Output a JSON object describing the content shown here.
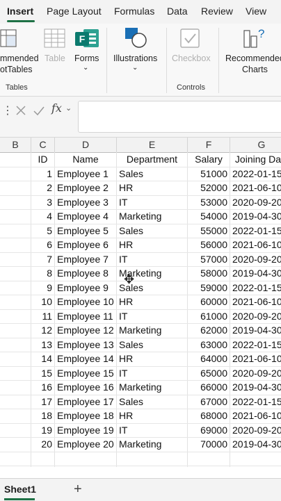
{
  "ribbon_tabs": [
    "Insert",
    "Page Layout",
    "Formulas",
    "Data",
    "Review",
    "View"
  ],
  "active_tab": "Insert",
  "ribbon": {
    "pivot_label_1": "mmended",
    "pivot_label_2": "otTables",
    "table_label": "Table",
    "forms_label": "Forms",
    "forms_letter": "F",
    "illustrations_label": "Illustrations",
    "checkbox_label": "Checkbox",
    "rec_charts_label_1": "Recommended",
    "rec_charts_label_2": "Charts",
    "group_tables": "Tables",
    "group_controls": "Controls"
  },
  "formula_bar": {
    "fx": "fx",
    "value": ""
  },
  "columns": [
    "B",
    "C",
    "D",
    "E",
    "F",
    "G"
  ],
  "headers": [
    "ID",
    "Name",
    "Department",
    "Salary",
    "Joining Da"
  ],
  "rows": [
    [
      "1",
      "Employee 1",
      "Sales",
      "51000",
      "2022-01-15"
    ],
    [
      "2",
      "Employee 2",
      "HR",
      "52000",
      "2021-06-10"
    ],
    [
      "3",
      "Employee 3",
      "IT",
      "53000",
      "2020-09-20"
    ],
    [
      "4",
      "Employee 4",
      "Marketing",
      "54000",
      "2019-04-30"
    ],
    [
      "5",
      "Employee 5",
      "Sales",
      "55000",
      "2022-01-15"
    ],
    [
      "6",
      "Employee 6",
      "HR",
      "56000",
      "2021-06-10"
    ],
    [
      "7",
      "Employee 7",
      "IT",
      "57000",
      "2020-09-20"
    ],
    [
      "8",
      "Employee 8",
      "Marketing",
      "58000",
      "2019-04-30"
    ],
    [
      "9",
      "Employee 9",
      "Sales",
      "59000",
      "2022-01-15"
    ],
    [
      "10",
      "Employee 10",
      "HR",
      "60000",
      "2021-06-10"
    ],
    [
      "11",
      "Employee 11",
      "IT",
      "61000",
      "2020-09-20"
    ],
    [
      "12",
      "Employee 12",
      "Marketing",
      "62000",
      "2019-04-30"
    ],
    [
      "13",
      "Employee 13",
      "Sales",
      "63000",
      "2022-01-15"
    ],
    [
      "14",
      "Employee 14",
      "HR",
      "64000",
      "2021-06-10"
    ],
    [
      "15",
      "Employee 15",
      "IT",
      "65000",
      "2020-09-20"
    ],
    [
      "16",
      "Employee 16",
      "Marketing",
      "66000",
      "2019-04-30"
    ],
    [
      "17",
      "Employee 17",
      "Sales",
      "67000",
      "2022-01-15"
    ],
    [
      "18",
      "Employee 18",
      "HR",
      "68000",
      "2021-06-10"
    ],
    [
      "19",
      "Employee 19",
      "IT",
      "69000",
      "2020-09-20"
    ],
    [
      "20",
      "Employee 20",
      "Marketing",
      "70000",
      "2019-04-30"
    ]
  ],
  "sheet_tabs": [
    "Sheet1"
  ],
  "add_sheet_symbol": "+",
  "colors": {
    "accent": "#1e7145",
    "forms": "#0b7a6e",
    "icon_blue": "#1a6fb5"
  }
}
